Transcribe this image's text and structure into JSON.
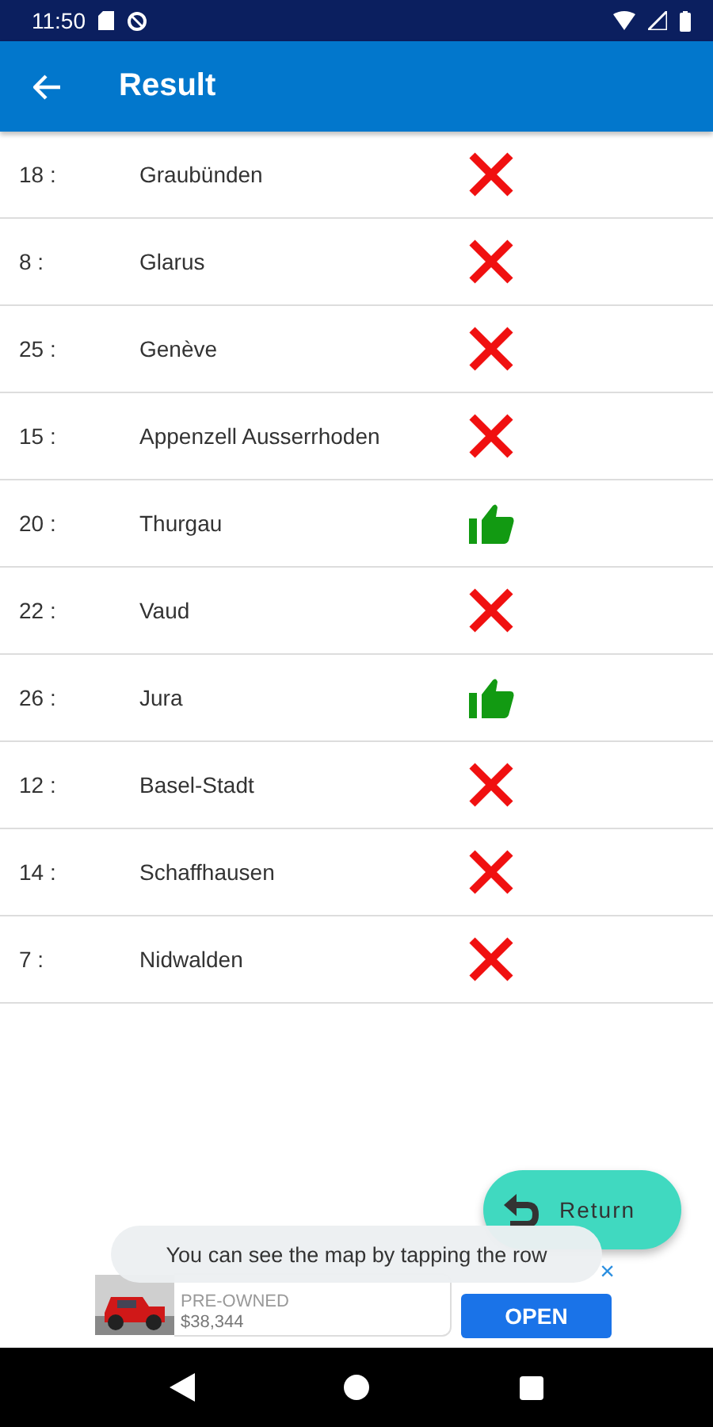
{
  "status_bar": {
    "time": "11:50"
  },
  "app_bar": {
    "title": "Result"
  },
  "rows": [
    {
      "number": "18 :",
      "name": "Graubünden",
      "correct": false
    },
    {
      "number": "8 :",
      "name": "Glarus",
      "correct": false
    },
    {
      "number": "25 :",
      "name": "Genève",
      "correct": false
    },
    {
      "number": "15 :",
      "name": "Appenzell Ausserrhoden",
      "correct": false
    },
    {
      "number": "20 :",
      "name": "Thurgau",
      "correct": true
    },
    {
      "number": "22 :",
      "name": "Vaud",
      "correct": false
    },
    {
      "number": "26 :",
      "name": "Jura",
      "correct": true
    },
    {
      "number": "12 :",
      "name": "Basel-Stadt",
      "correct": false
    },
    {
      "number": "14 :",
      "name": "Schaffhausen",
      "correct": false
    },
    {
      "number": "7 :",
      "name": "Nidwalden",
      "correct": false
    }
  ],
  "return_button": {
    "label": "Return"
  },
  "toast": {
    "text": "You can see the map by tapping the row"
  },
  "ad": {
    "title": "PRE-OWNED",
    "price": "$38,344",
    "button": "OPEN",
    "close": "×"
  }
}
